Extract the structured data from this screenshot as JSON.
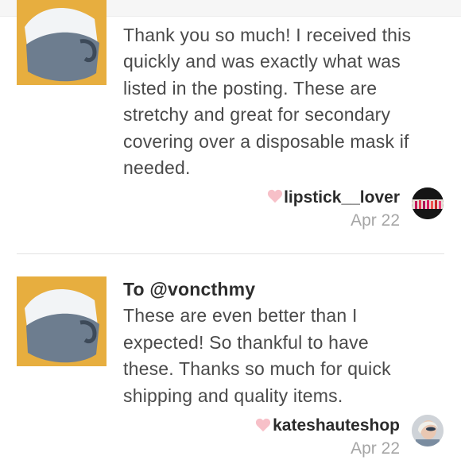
{
  "reviews": [
    {
      "to": "",
      "text_lines": [
        "Thank you so much! I received this",
        "quickly and was exactly what was",
        "listed in the posting. These are",
        "stretchy and great for secondary",
        "covering over a disposable mask if",
        "needed."
      ],
      "author": "lipstick__lover",
      "date": "Apr 22",
      "product_image": "mask-image",
      "avatar_image": "lipstick-avatar"
    },
    {
      "to": "To @voncthmy",
      "text_lines": [
        "These are even better than I",
        "expected! So thankful to have",
        "these. Thanks so much for quick",
        "shipping and quality items."
      ],
      "author": "kateshauteshop",
      "date": "Apr 22",
      "product_image": "mask-image",
      "avatar_image": "profile-avatar"
    }
  ],
  "colors": {
    "heart": "#f7c0c8",
    "thumb_bg": "#e7ae3f",
    "mask_gray": "#6d7d8f",
    "mask_white": "#f2f4f6"
  }
}
